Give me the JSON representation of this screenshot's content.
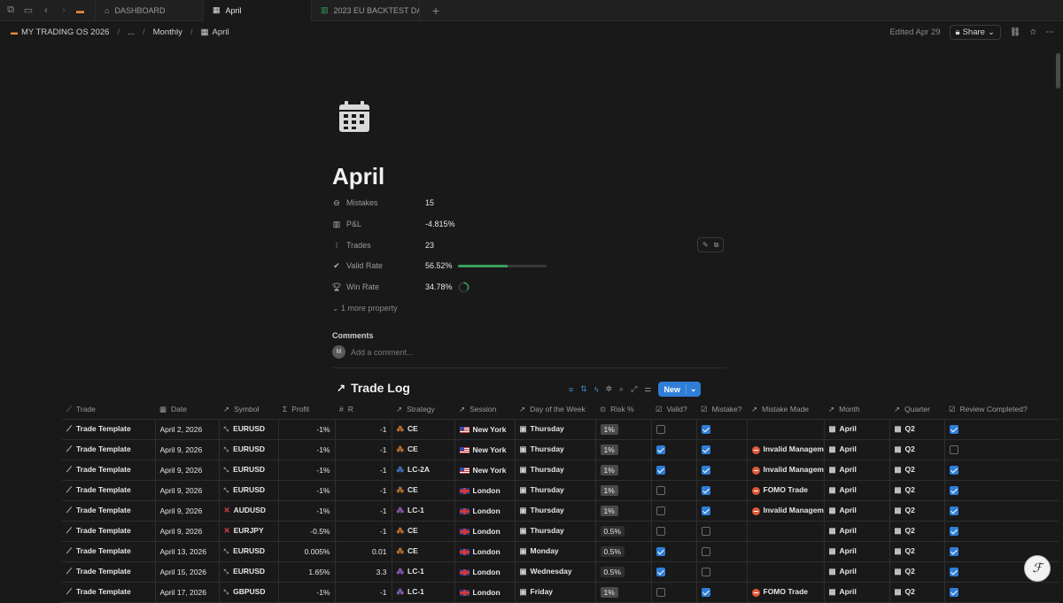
{
  "tabs": [
    {
      "label": "DASHBOARD",
      "icon": "home-icon",
      "active": false
    },
    {
      "label": "April",
      "icon": "calendar-icon",
      "active": true
    },
    {
      "label": "2023 EU BACKTEST DAT/",
      "icon": "chart-icon",
      "active": false
    }
  ],
  "breadcrumb": {
    "workspace": "MY TRADING OS 2026",
    "ellipsis": "...",
    "parent": "Monthly",
    "current": "April"
  },
  "topbar": {
    "edited": "Edited Apr 29",
    "share_label": "Share"
  },
  "page": {
    "title": "April",
    "properties": [
      {
        "name": "Mistakes",
        "icon": "minus-circle-icon",
        "value": "15"
      },
      {
        "name": "P&L",
        "icon": "bar-chart-icon",
        "value": "-4.815%"
      },
      {
        "name": "Trades",
        "icon": "dots-icon",
        "value": "23"
      },
      {
        "name": "Valid Rate",
        "icon": "check-circle-icon",
        "value": "56.52%",
        "progress": 0.5652
      },
      {
        "name": "Win Rate",
        "icon": "trophy-icon",
        "value": "34.78%",
        "progress": 0.3478
      }
    ],
    "more_property": "1 more property",
    "comments_label": "Comments",
    "comment_placeholder": "Add a comment...",
    "avatar_letter": "M"
  },
  "database": {
    "title": "Trade Log",
    "new_label": "New",
    "columns": [
      "Trade",
      "Date",
      "Symbol",
      "Profit",
      "R",
      "Strategy",
      "Session",
      "Day of the Week",
      "Risk %",
      "Valid?",
      "Mistake?",
      "Mistake Made",
      "Month",
      "Quarter",
      "Review Completed?"
    ],
    "rows": [
      {
        "trade": "Trade Template",
        "date": "April 2, 2026",
        "symbol": "EURUSD",
        "sym_x": false,
        "profit": "-1%",
        "r": "-1",
        "strategy": "CE",
        "strat_color": "orange",
        "session": "New York",
        "flag": "us",
        "day": "Thursday",
        "risk": "1%",
        "risk_pill": true,
        "valid": false,
        "mistake": true,
        "mistake_made": "",
        "month": "April",
        "quarter": "Q2",
        "review": true
      },
      {
        "trade": "Trade Template",
        "date": "April 9, 2026",
        "symbol": "EURUSD",
        "sym_x": false,
        "profit": "-1%",
        "r": "-1",
        "strategy": "CE",
        "strat_color": "orange",
        "session": "New York",
        "flag": "us",
        "day": "Thursday",
        "risk": "1%",
        "risk_pill": true,
        "valid": true,
        "mistake": true,
        "mistake_made": "Invalid Managem",
        "month": "April",
        "quarter": "Q2",
        "review": false
      },
      {
        "trade": "Trade Template",
        "date": "April 9, 2026",
        "symbol": "EURUSD",
        "sym_x": false,
        "profit": "-1%",
        "r": "-1",
        "strategy": "LC-2A",
        "strat_color": "blue",
        "session": "New York",
        "flag": "us",
        "day": "Thursday",
        "risk": "1%",
        "risk_pill": true,
        "valid": true,
        "mistake": true,
        "mistake_made": "Invalid Managem",
        "month": "April",
        "quarter": "Q2",
        "review": true
      },
      {
        "trade": "Trade Template",
        "date": "April 9, 2026",
        "symbol": "EURUSD",
        "sym_x": false,
        "profit": "-1%",
        "r": "-1",
        "strategy": "CE",
        "strat_color": "orange",
        "session": "London",
        "flag": "uk",
        "day": "Thursday",
        "risk": "1%",
        "risk_pill": true,
        "valid": false,
        "mistake": true,
        "mistake_made": "FOMO Trade",
        "month": "April",
        "quarter": "Q2",
        "review": true
      },
      {
        "trade": "Trade Template",
        "date": "April 9, 2026",
        "symbol": "AUDUSD",
        "sym_x": true,
        "profit": "-1%",
        "r": "-1",
        "strategy": "LC-1",
        "strat_color": "purple",
        "session": "London",
        "flag": "uk",
        "day": "Thursday",
        "risk": "1%",
        "risk_pill": true,
        "valid": false,
        "mistake": true,
        "mistake_made": "Invalid Managem",
        "month": "April",
        "quarter": "Q2",
        "review": true
      },
      {
        "trade": "Trade Template",
        "date": "April 9, 2026",
        "symbol": "EURJPY",
        "sym_x": true,
        "profit": "-0.5%",
        "r": "-1",
        "strategy": "CE",
        "strat_color": "orange",
        "session": "London",
        "flag": "uk",
        "day": "Thursday",
        "risk": "0.5%",
        "risk_pill": false,
        "valid": false,
        "mistake": false,
        "mistake_made": "",
        "month": "April",
        "quarter": "Q2",
        "review": true
      },
      {
        "trade": "Trade Template",
        "date": "April 13, 2026",
        "symbol": "EURUSD",
        "sym_x": false,
        "profit": "0.005%",
        "r": "0.01",
        "strategy": "CE",
        "strat_color": "orange",
        "session": "London",
        "flag": "uk",
        "day": "Monday",
        "risk": "0.5%",
        "risk_pill": false,
        "valid": true,
        "mistake": false,
        "mistake_made": "",
        "month": "April",
        "quarter": "Q2",
        "review": true
      },
      {
        "trade": "Trade Template",
        "date": "April 15, 2026",
        "symbol": "EURUSD",
        "sym_x": false,
        "profit": "1.65%",
        "r": "3.3",
        "strategy": "LC-1",
        "strat_color": "purple",
        "session": "London",
        "flag": "uk",
        "day": "Wednesday",
        "risk": "0.5%",
        "risk_pill": false,
        "valid": true,
        "mistake": false,
        "mistake_made": "",
        "month": "April",
        "quarter": "Q2",
        "review": true
      },
      {
        "trade": "Trade Template",
        "date": "April 17, 2026",
        "symbol": "GBPUSD",
        "sym_x": false,
        "profit": "-1%",
        "r": "-1",
        "strategy": "LC-1",
        "strat_color": "purple",
        "session": "London",
        "flag": "uk",
        "day": "Friday",
        "risk": "1%",
        "risk_pill": true,
        "valid": false,
        "mistake": true,
        "mistake_made": "FOMO Trade",
        "month": "April",
        "quarter": "Q2",
        "review": true
      }
    ]
  }
}
